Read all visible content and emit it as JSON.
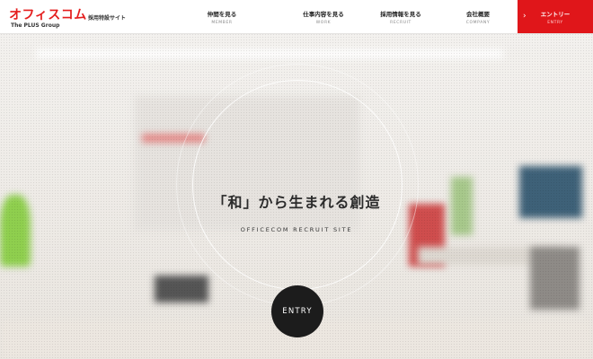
{
  "header": {
    "logo_text": "オフィスコム",
    "logo_sub": "The PLUS Group",
    "site_label": "採用特設サイト",
    "nav": [
      {
        "jp": "仲間を見る",
        "en": "MEMBER"
      },
      {
        "jp": "仕事内容を見る",
        "en": "WORK"
      },
      {
        "jp": "採用情報を見る",
        "en": "RECRUIT"
      },
      {
        "jp": "会社概要",
        "en": "COMPANY"
      }
    ],
    "entry": {
      "jp": "エントリー",
      "en": "ENTRY",
      "icon": "chevron-right-icon"
    }
  },
  "hero": {
    "title": "「和」から生まれる創造",
    "subtitle": "OFFICECOM RECRUIT SITE",
    "entry_button": "ENTRY"
  },
  "colors": {
    "brand_red": "#e0161a",
    "entry_button_bg": "#1c1c1c",
    "text_dark": "#2b2b2b"
  }
}
